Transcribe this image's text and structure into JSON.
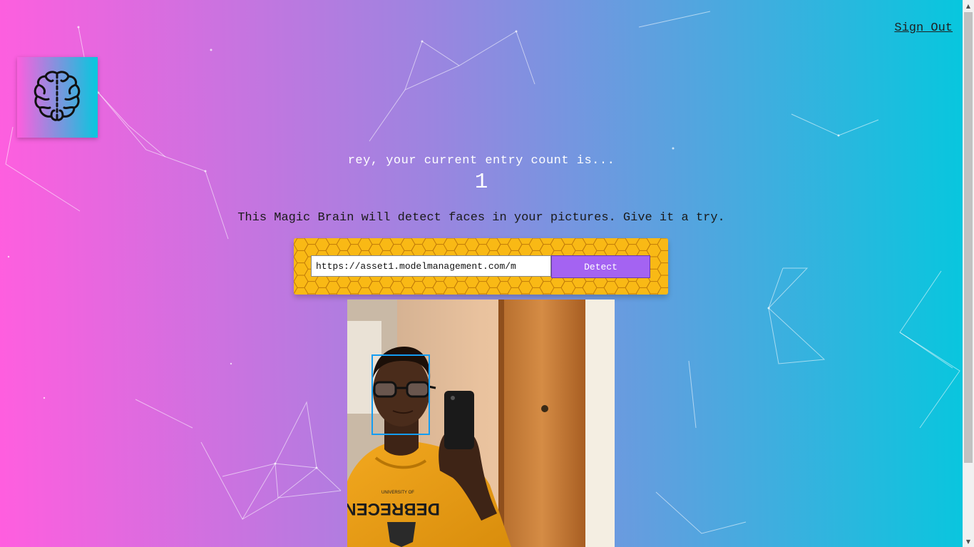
{
  "nav": {
    "sign_out_label": "Sign Out"
  },
  "logo": {
    "icon": "brain-icon"
  },
  "rank": {
    "message": "rey, your current entry count is...",
    "count": "1"
  },
  "image_link_form": {
    "tagline": "This Magic Brain will detect faces in your pictures. Give it a try.",
    "url_value": "https://asset1.modelmanagement.com/m",
    "detect_label": "Detect"
  },
  "colors": {
    "gradient_start": "#ff5edf",
    "gradient_end": "#04c8de",
    "form_panel": "#f9b915",
    "detect_button": "#a463f2",
    "face_box": "#149df2"
  },
  "face_recognition": {
    "faces_detected": 1,
    "photo_text": [
      "UNIVERSITY OF",
      "DEBRECEN"
    ]
  }
}
